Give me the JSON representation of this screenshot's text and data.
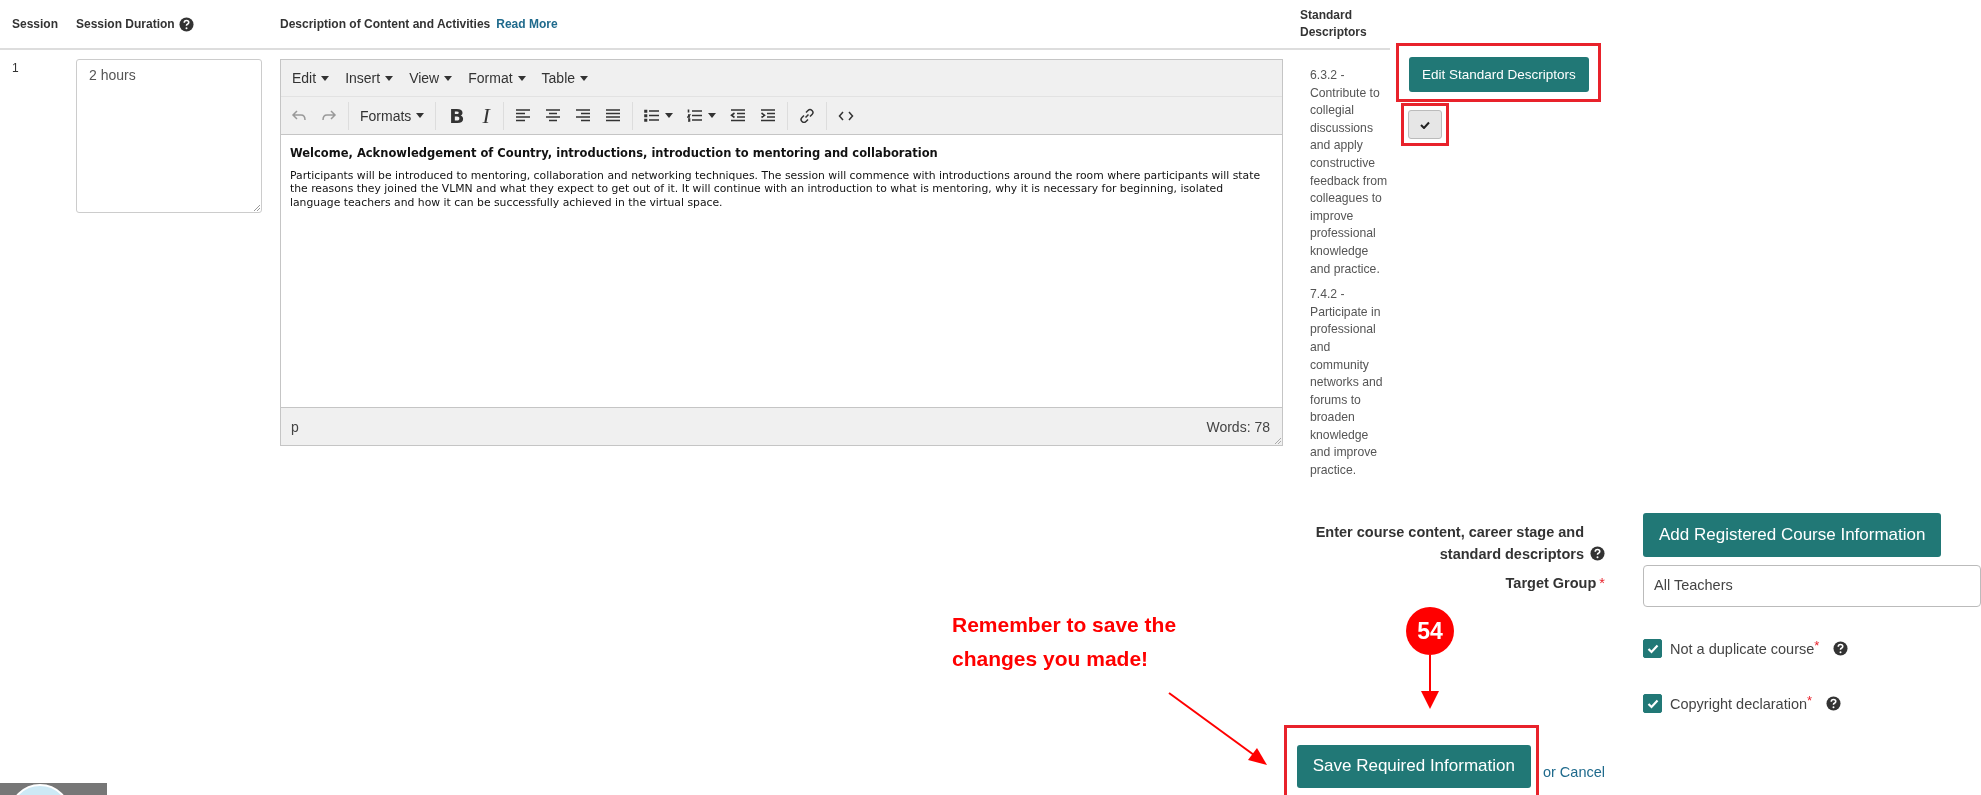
{
  "table": {
    "columns": [
      {
        "label": "Session"
      },
      {
        "label": "Session Duration",
        "help": true
      },
      {
        "label": "Description of Content and Activities",
        "link": "Read More"
      },
      {
        "label": "Standard Descriptors"
      }
    ],
    "rows": [
      {
        "session": "1",
        "duration": "2 hours",
        "editor": {
          "menus": [
            "Edit",
            "Insert",
            "View",
            "Format",
            "Table"
          ],
          "tools": [
            {
              "kind": "undo",
              "disabled": true
            },
            {
              "kind": "redo",
              "disabled": true
            },
            {
              "kind": "sep"
            },
            {
              "kind": "dropdown",
              "label": "Formats"
            },
            {
              "kind": "sep"
            },
            {
              "kind": "bold",
              "label": "B"
            },
            {
              "kind": "italic",
              "label": "I"
            },
            {
              "kind": "sep"
            },
            {
              "kind": "align-left"
            },
            {
              "kind": "align-center"
            },
            {
              "kind": "align-right"
            },
            {
              "kind": "justify"
            },
            {
              "kind": "sep"
            },
            {
              "kind": "bullet-list"
            },
            {
              "kind": "numbered-list"
            },
            {
              "kind": "outdent"
            },
            {
              "kind": "indent"
            },
            {
              "kind": "sep"
            },
            {
              "kind": "link"
            },
            {
              "kind": "sep"
            },
            {
              "kind": "code"
            }
          ],
          "heading": "Welcome, Acknowledgement of Country, introductions, introduction to mentoring and collaboration",
          "body": "Participants will be introduced to mentoring, collaboration and networking techniques. The session will commence with introductions around the room where participants will state the reasons they joined the VLMN and what they expect to get out of it. It will continue with an introduction to what is mentoring, why it is necessary for beginning, isolated language teachers and how it can be successfully achieved in the virtual space.",
          "path": "p",
          "word_count": "Words: 78"
        },
        "descriptors": [
          "6.3.2 - Contribute to collegial discussions and apply constructive feedback from colleagues to improve professional knowledge and practice.",
          "7.4.2 - Participate in professional and community networks and forums to broaden knowledge and improve practice."
        ],
        "edit_button": {
          "label": "Edit Standard Descriptors",
          "highlighted": true
        },
        "confirm_button": {
          "kind": "check",
          "highlighted": true
        }
      }
    ]
  },
  "course_info": {
    "label": "Enter course content, career stage and standard descriptors",
    "help": true,
    "button": "Add Registered Course Information"
  },
  "target_group": {
    "label": "Target Group",
    "required_mark": "*",
    "value": "All Teachers"
  },
  "checkboxes": [
    {
      "label": "Not a duplicate course",
      "checked": true,
      "required_mark": "*",
      "help": true
    },
    {
      "label": "Copyright declaration",
      "checked": true,
      "required_mark": "*",
      "help": true
    }
  ],
  "actions": {
    "save": {
      "label": "Save Required Information",
      "highlighted": true
    },
    "cancel": "or Cancel"
  },
  "annotations": {
    "note": "Remember to save the changes you made!",
    "step": "54"
  }
}
